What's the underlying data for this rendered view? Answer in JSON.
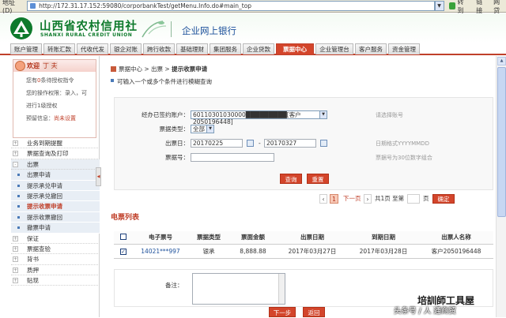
{
  "browser": {
    "address_label": "地址(D)",
    "url": "http://172.31.17.152:59080/corporbankTest/getMenu.Info.do#main_top",
    "go_label": "转到",
    "links_label": "链接",
    "extra_label": "网贷"
  },
  "header": {
    "bank_name_cn": "山西省农村信用社",
    "bank_name_en": "SHANXI RURAL CREDIT UNION",
    "product_name": "企业网上银行",
    "brand_color": "#0e7a2c"
  },
  "nav": {
    "tabs": [
      "账户管理",
      "转账汇款",
      "代收代发",
      "银企对账",
      "跨行收款",
      "基础理财",
      "集团服务",
      "企业贷款",
      "票据中心",
      "企业管理台",
      "客户服务",
      "资金管理"
    ],
    "active_index": 8,
    "active_color": "#d3452b"
  },
  "user": {
    "welcome": "欢迎",
    "name": "丁    夫",
    "line1_prefix": "您有",
    "line1_highlight": "0",
    "line1_suffix": "条待授权指令",
    "line2": "您的操作权限：录入，可",
    "line3": "进行1级授权",
    "line4_prefix": "预留信息：",
    "line4_highlight": "尚未设置"
  },
  "sidebar": {
    "items": [
      {
        "label": "业务到期提醒",
        "type": "item",
        "mark": "+"
      },
      {
        "label": "票据查询及打印",
        "type": "item",
        "mark": "+"
      },
      {
        "label": "出票",
        "type": "open",
        "mark": "-"
      },
      {
        "label": "出票申请",
        "type": "sub"
      },
      {
        "label": "提示承兑申请",
        "type": "sub"
      },
      {
        "label": "提示承兑撤回",
        "type": "sub"
      },
      {
        "label": "提示收票申请",
        "type": "sub",
        "active": true
      },
      {
        "label": "提示收票撤回",
        "type": "sub"
      },
      {
        "label": "撤票申请",
        "type": "sub"
      },
      {
        "label": "保证",
        "type": "item",
        "mark": "+"
      },
      {
        "label": "票据查验",
        "type": "item",
        "mark": "+"
      },
      {
        "label": "背书",
        "type": "item",
        "mark": "+"
      },
      {
        "label": "质押",
        "type": "item",
        "mark": "+"
      },
      {
        "label": "贴现",
        "type": "item",
        "mark": "+"
      }
    ],
    "toggle_glyph": "◀"
  },
  "main": {
    "breadcrumb_prefix": "票据中心 > 出票 > ",
    "breadcrumb_current": "提示收票申请",
    "hint": "可输入一个或多个条件进行模糊查询",
    "form": {
      "account_label": "经办已签约账户：",
      "account_value": "60110301030000█████████[客户2050196448]",
      "account_note": "请选择账号",
      "type_label": "票据类型：",
      "type_value": "全部",
      "date_label": "出票日：",
      "date_from": "20170225",
      "date_sep": "-",
      "date_to": "20170327",
      "date_note": "日期格式YYYYMMDD",
      "number_label": "票据号：",
      "number_value": "",
      "number_note": "票据号为30位数字组合",
      "query_button": "查询",
      "reset_button": "重置"
    },
    "pager": {
      "prev": "‹",
      "page": "1",
      "next_page": "下一页",
      "next": "›",
      "total_text": "共1页 至第",
      "page_input": "",
      "page_unit": "页",
      "confirm": "确定"
    },
    "list_title": "电票列表",
    "table": {
      "headers": [
        "",
        "电子票号",
        "票据类型",
        "票面金额",
        "出票日期",
        "到期日期",
        "出票人名称"
      ],
      "rows": [
        {
          "checked": "✓",
          "number": "14021***997",
          "type": "银承",
          "amount": "8,888.88",
          "issue_date": "2017年03月27日",
          "due_date": "2017年03月28日",
          "drawer": "客户2050196448"
        }
      ]
    },
    "remark_label": "备注：",
    "next_button": "下一步",
    "back_button": "返回"
  },
  "watermark": {
    "line1": "培訓師工具屋",
    "line2": "头条号 / 人 通商贸"
  }
}
